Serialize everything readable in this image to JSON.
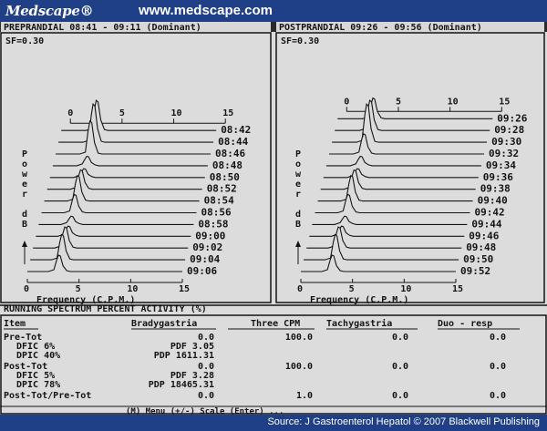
{
  "header": {
    "logo": "Medscape®",
    "url": "www.medscape.com"
  },
  "footer": {
    "source": "Source: J Gastroenterol Hepatol © 2007 Blackwell Publishing"
  },
  "colors": {
    "brand_bar": "#1f3f86",
    "screen_bg": "#dcdcdc",
    "ink": "#141414"
  },
  "panels": [
    {
      "title": "PREPRANDIAL 08:41 - 09:11 (Dominant)",
      "sf": "SF=0.30",
      "ticks": [
        "0",
        "5",
        "10",
        "15"
      ],
      "times": [
        "09:06",
        "09:04",
        "09:02",
        "09:00",
        "08:58",
        "08:56",
        "08:54",
        "08:52",
        "08:50",
        "08:48",
        "08:46",
        "08:44",
        "08:42"
      ],
      "y_axis": [
        "P",
        "o",
        "w",
        "e",
        "r",
        "",
        "d",
        "B"
      ],
      "xlabel": "Frequency (C.P.M.)"
    },
    {
      "title": "POSTPRANDIAL 09:26 - 09:56 (Dominant)",
      "sf": "SF=0.30",
      "ticks": [
        "0",
        "5",
        "10",
        "15"
      ],
      "times": [
        "09:52",
        "09:50",
        "09:48",
        "09:46",
        "09:44",
        "09:42",
        "09:40",
        "09:38",
        "09:36",
        "09:34",
        "09:32",
        "09:30",
        "09:28",
        "09:26"
      ],
      "y_axis": [
        "P",
        "o",
        "w",
        "e",
        "r",
        "",
        "d",
        "B"
      ],
      "xlabel": "Frequency (C.P.M.)"
    }
  ],
  "table": {
    "title": "RUNNING SPECTRUM PERCENT ACTIVITY (%)",
    "headers": [
      "Item",
      "Bradygastria",
      "Three CPM",
      "Tachygastria",
      "Duo - resp"
    ],
    "rows": [
      {
        "item": "Pre-Tot",
        "brady": "0.0",
        "three": "100.0",
        "tachy": "0.0",
        "duo": "0.0"
      },
      {
        "item": "DFIC 6%",
        "brady": "PDF 3.05",
        "three": "",
        "tachy": "",
        "duo": ""
      },
      {
        "item": "DPIC 40%",
        "brady": "PDP 1611.31",
        "three": "",
        "tachy": "",
        "duo": ""
      },
      {
        "item": "Post-Tot",
        "brady": "0.0",
        "three": "100.0",
        "tachy": "0.0",
        "duo": "0.0"
      },
      {
        "item": "DFIC 5%",
        "brady": "PDF 3.28",
        "three": "",
        "tachy": "",
        "duo": ""
      },
      {
        "item": "DPIC 78%",
        "brady": "PDP 18465.31",
        "three": "",
        "tachy": "",
        "duo": ""
      },
      {
        "item": "Post-Tot/Pre-Tot",
        "brady": "0.0",
        "three": "1.0",
        "tachy": "0.0",
        "duo": "0.0"
      }
    ],
    "footer_partial": "(M) Menu (+/-) Scale (Enter) ..."
  }
}
